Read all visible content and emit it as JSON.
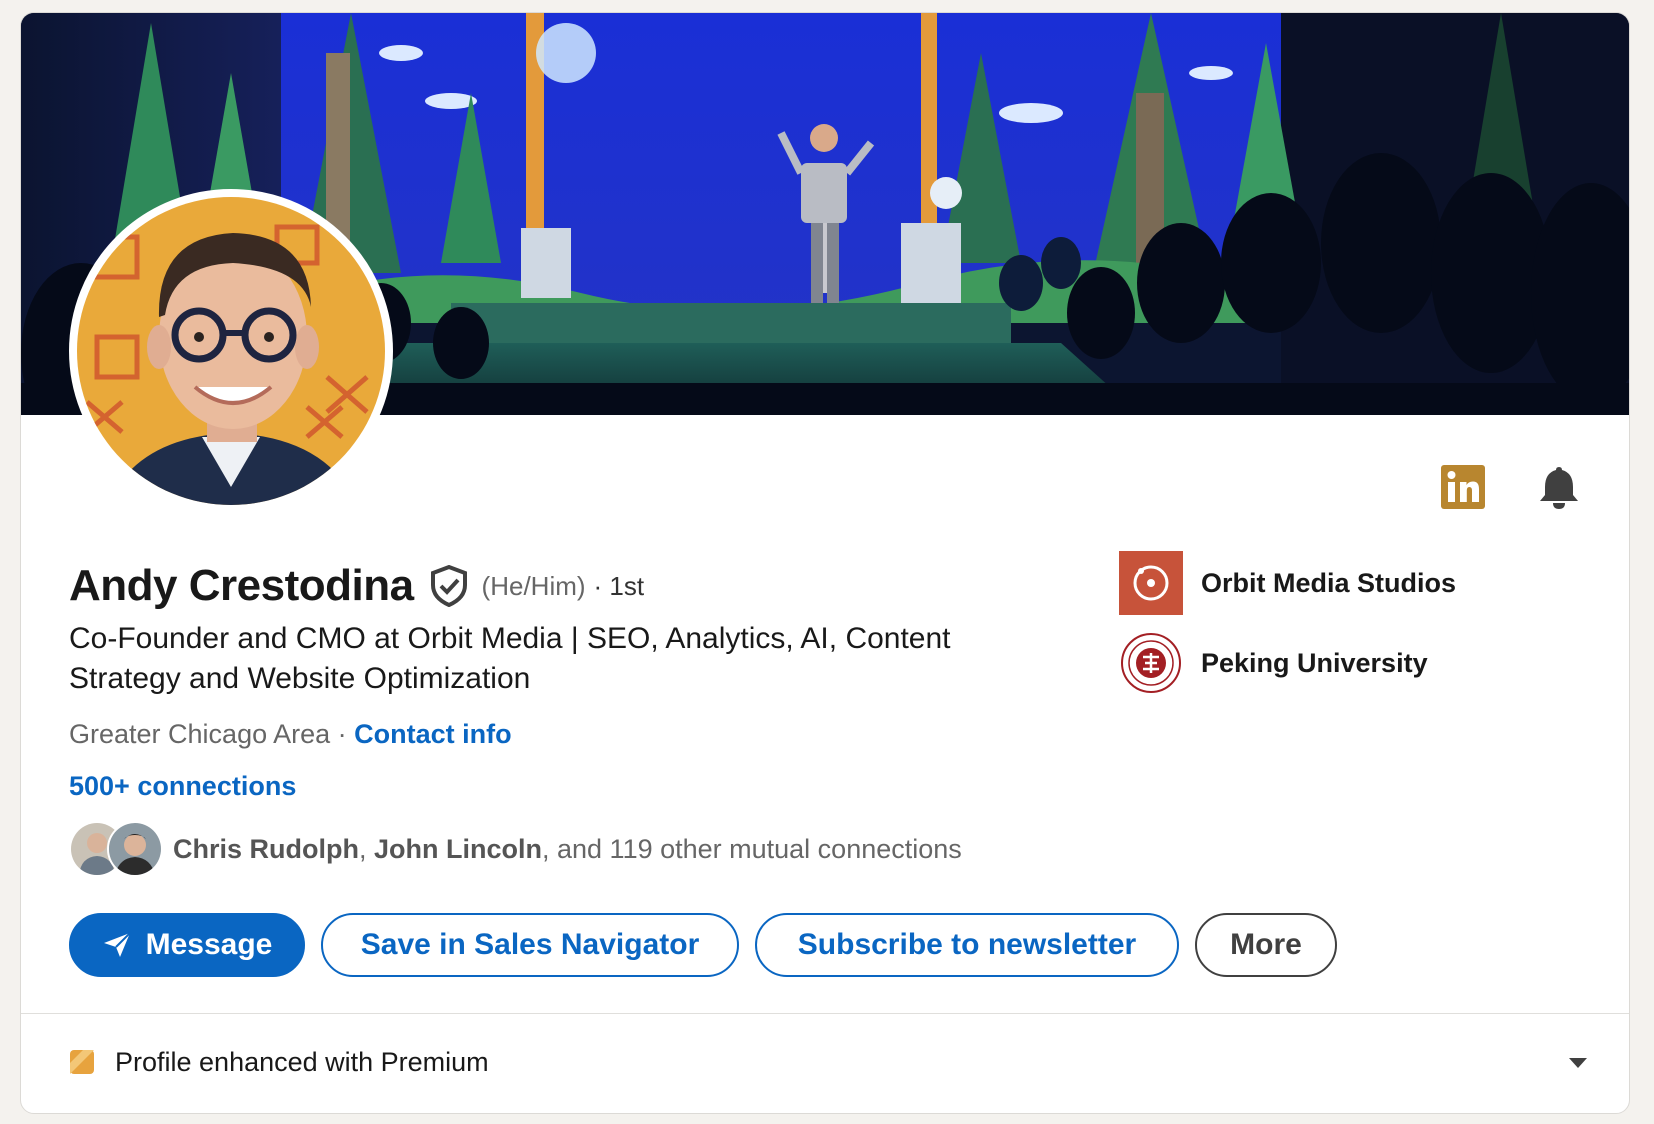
{
  "profile": {
    "name": "Andy Crestodina",
    "pronouns": "(He/Him)",
    "degree": "· 1st",
    "headline": "Co-Founder and CMO at Orbit Media | SEO, Analytics, AI, Content Strategy and Website Optimization",
    "location": "Greater Chicago Area",
    "location_separator": " · ",
    "contact_info": "Contact info",
    "connections": "500+ connections"
  },
  "mutual": {
    "name1": "Chris Rudolph",
    "separator": ", ",
    "name2": "John Lincoln",
    "rest": ", and 119 other mutual connections"
  },
  "actions": {
    "message": "Message",
    "sales_navigator": "Save in Sales Navigator",
    "newsletter": "Subscribe to newsletter",
    "more": "More"
  },
  "orgs": [
    {
      "name": "Orbit Media Studios",
      "logo_color": "#c7533a"
    },
    {
      "name": "Peking University",
      "logo_color": "#a31f24"
    }
  ],
  "premium": {
    "label": "Profile enhanced with Premium",
    "icon_color": "#e7a33e"
  },
  "icons": {
    "linkedin": "linkedin-logo-icon",
    "bell": "bell-icon",
    "verify": "verified-shield-icon",
    "send": "paper-plane-icon",
    "premium": "premium-badge-icon",
    "chevron": "chevron-down-icon"
  },
  "colors": {
    "brand_blue": "#0a66c2",
    "premium_gold": "#b8862f"
  }
}
